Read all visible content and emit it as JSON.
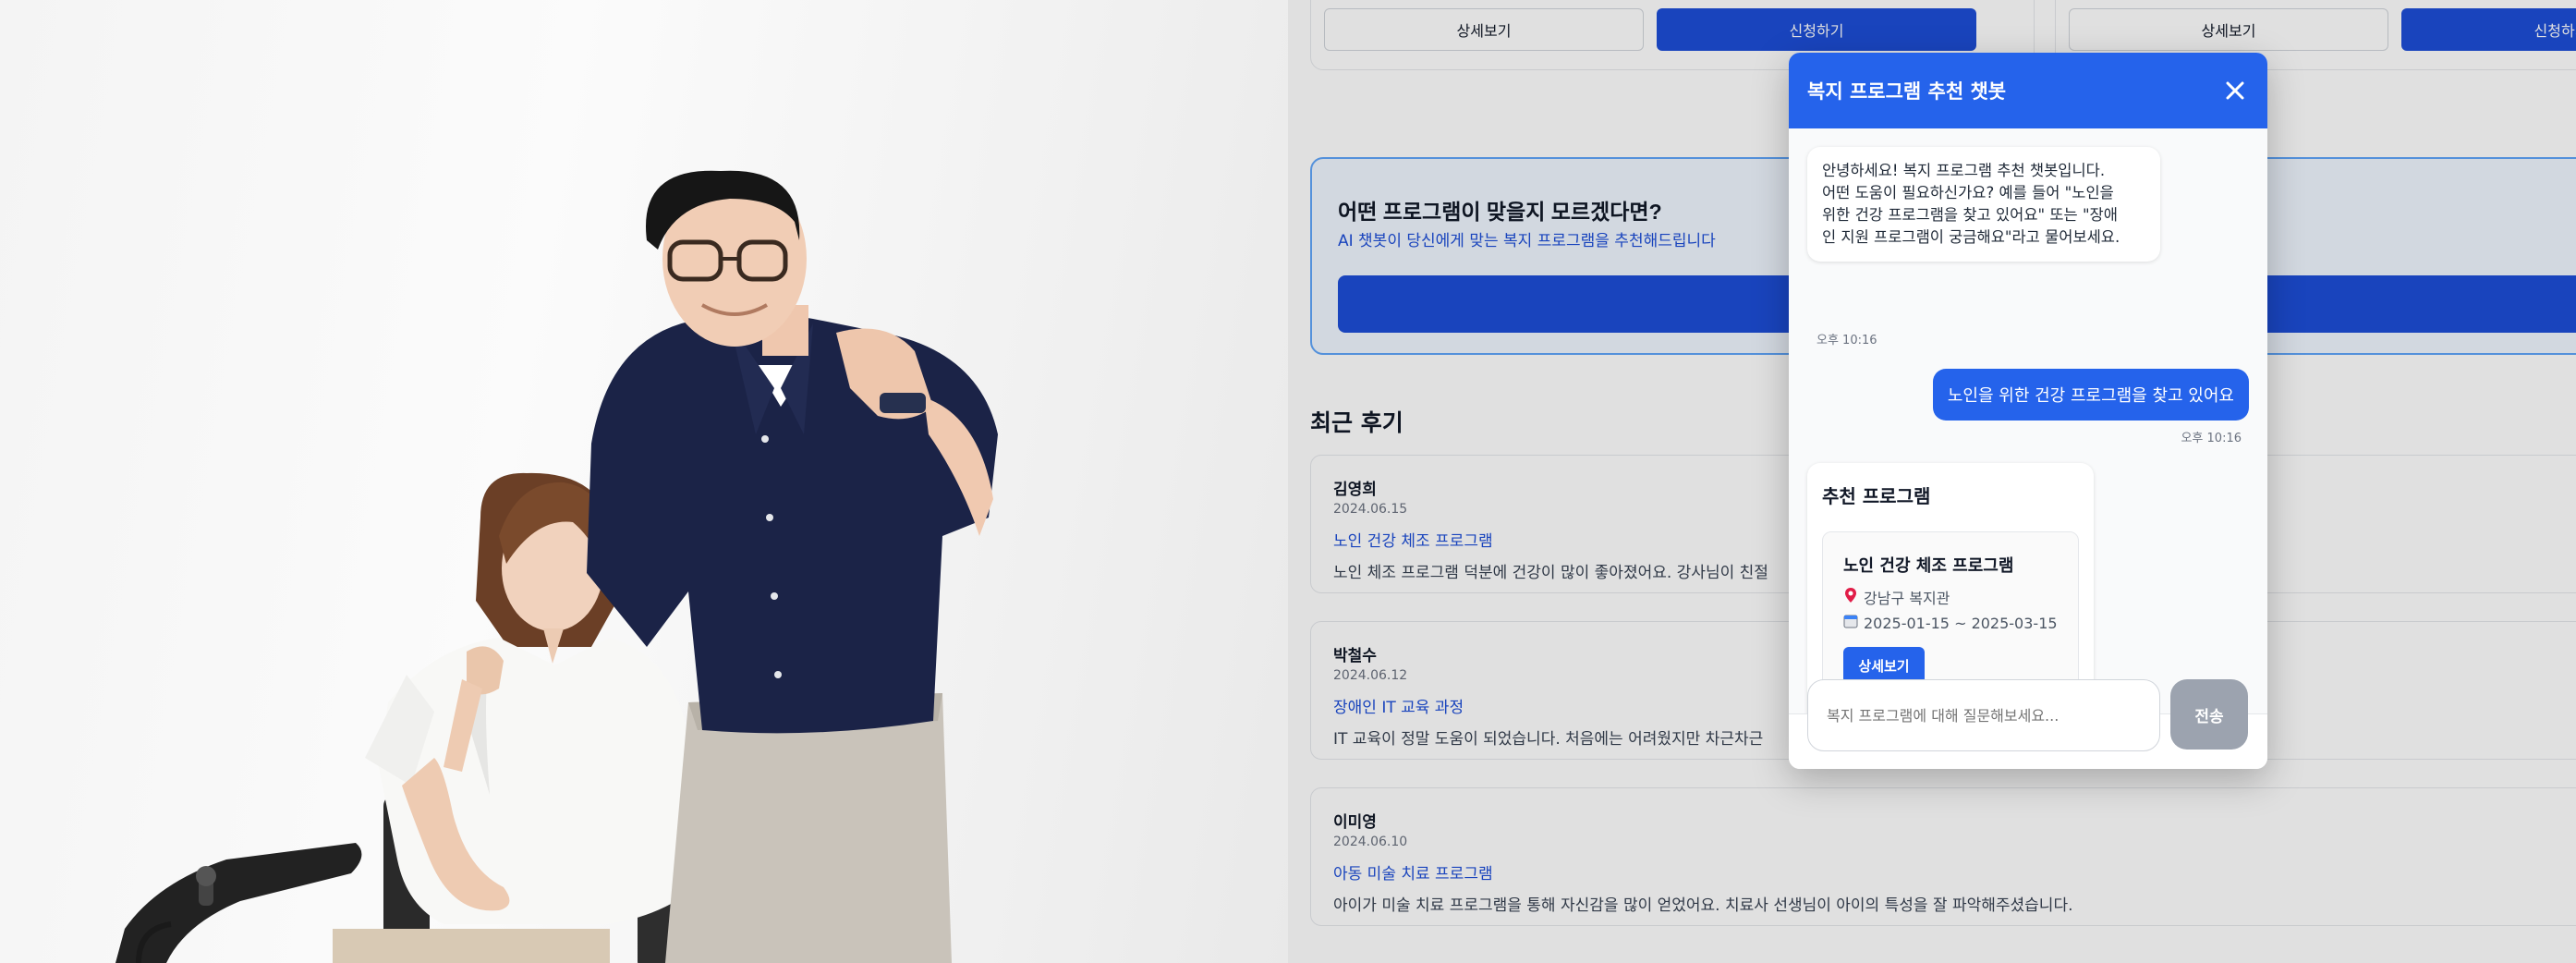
{
  "program_cards": [
    {
      "details_label": "상세보기",
      "apply_label": "신청하기"
    },
    {
      "details_label": "상세보기",
      "apply_label": "신청하기"
    }
  ],
  "ai_section": {
    "title": "어떤 프로그램이 맞을지 모르겠다면?",
    "subtitle": "AI 챗봇이 당신에게 맞는 복지 프로그램을 추천해드립니다"
  },
  "reviews": {
    "title": "최근 후기",
    "items": [
      {
        "name": "김영희",
        "date": "2024.06.15",
        "program": "노인 건강 체조 프로그램",
        "text": "노인 체조 프로그램 덕분에 건강이 많이 좋아졌어요. 강사님이 친절"
      },
      {
        "name": "박철수",
        "date": "2024.06.12",
        "program": "장애인 IT 교육 과정",
        "text": "IT 교육이 정말 도움이 되었습니다. 처음에는 어려웠지만 차근차근"
      },
      {
        "name": "이미영",
        "date": "2024.06.10",
        "program": "아동 미술 치료 프로그램",
        "text": "아이가 미술 치료 프로그램을 통해 자신감을 많이 얻었어요. 치료사 선생님이 아이의 특성을 잘 파악해주셨습니다."
      }
    ]
  },
  "chatbot": {
    "title": "복지 프로그램 추천 챗봇",
    "close_icon": "close-icon",
    "messages": {
      "bot_greeting_lines": [
        "안녕하세요! 복지 프로그램 추천 챗봇입니다.",
        "어떤 도움이 필요하신가요? 예를 들어 \"노인을",
        "위한 건강 프로그램을 찾고 있어요\" 또는 \"장애",
        "인 지원 프로그램이 궁금해요\"라고 물어보세요."
      ],
      "bot_time": "오후 10:16",
      "user_text": "노인을 위한 건강 프로그램을 찾고 있어요",
      "user_time": "오후 10:16"
    },
    "recommendation": {
      "title": "추천 프로그램",
      "program_name": "노인 건강 체조 프로그램",
      "location_icon": "pin-icon",
      "location": "강남구 복지관",
      "period_icon": "calendar-icon",
      "period": "2025-01-15 ~ 2025-03-15",
      "button_label": "상세보기"
    },
    "input_placeholder": "복지 프로그램에 대해 질문해보세요...",
    "send_label": "전송"
  },
  "colors": {
    "primary": "#2563eb",
    "primary_dark": "#1d4ed8",
    "send_disabled": "#9ca3af",
    "chat_background": "#f9fafb"
  }
}
